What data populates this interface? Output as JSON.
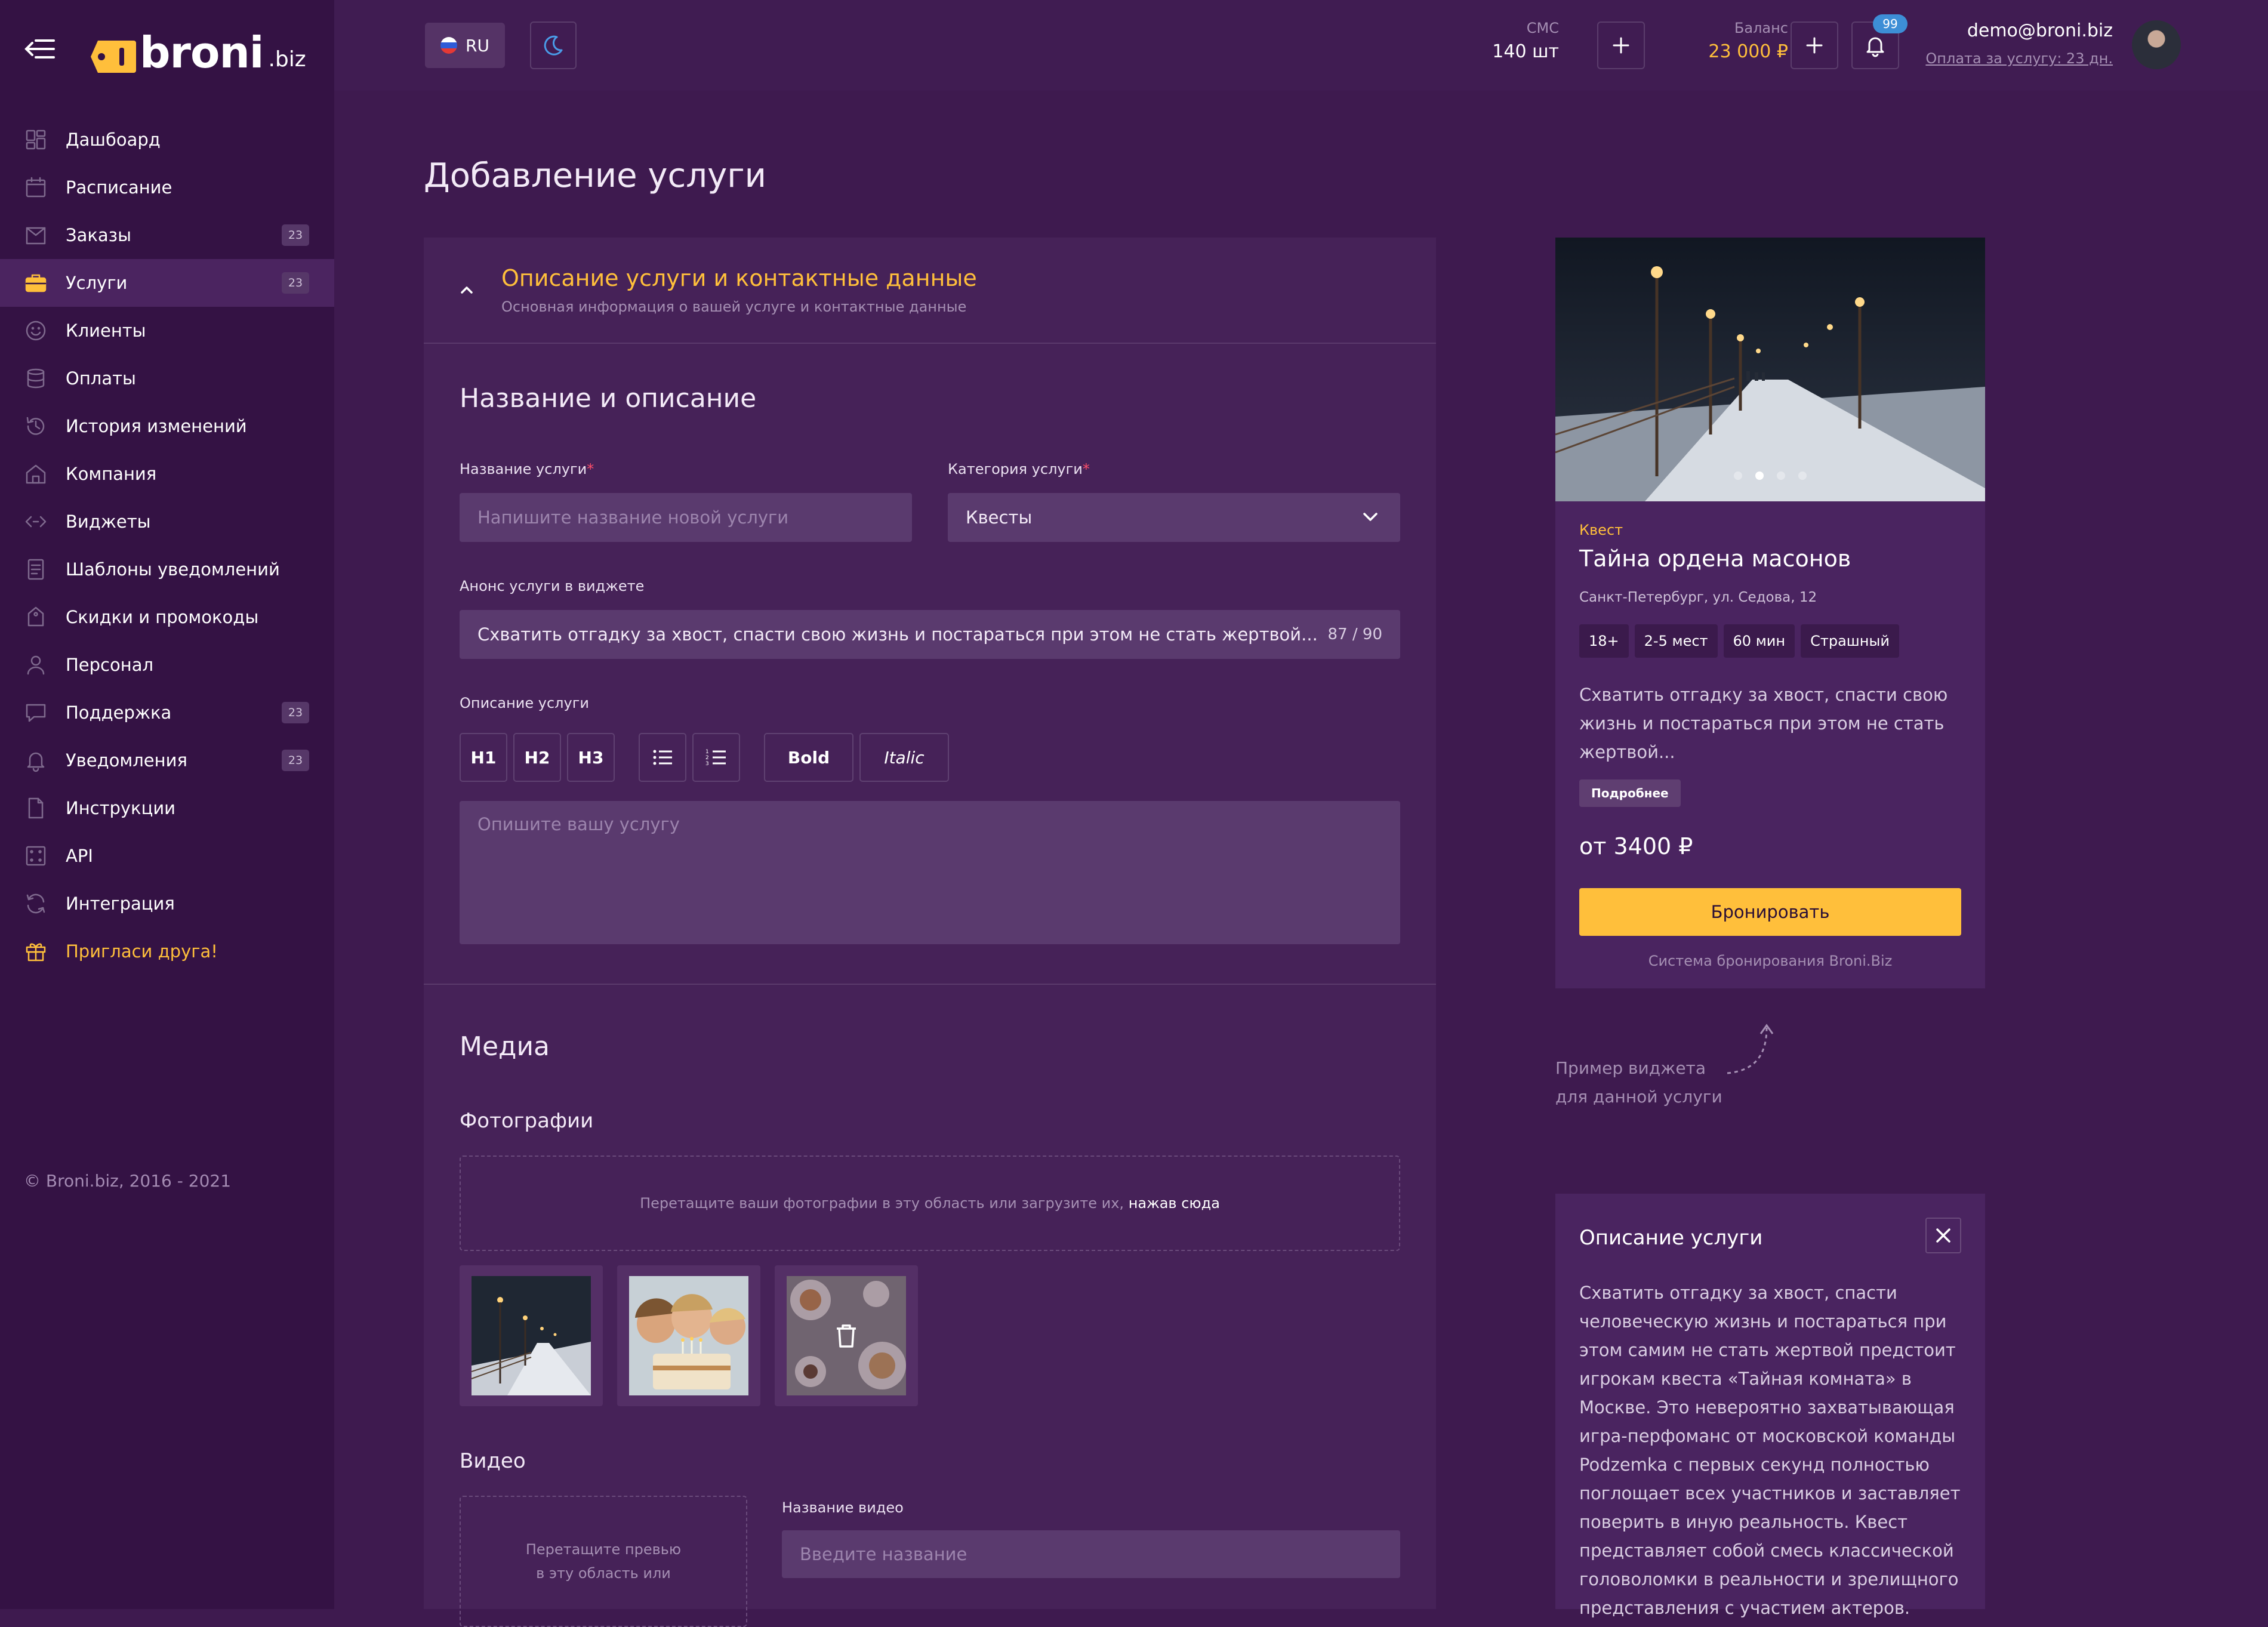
{
  "brand": {
    "name": "broni",
    "suffix": ".biz"
  },
  "sidebar": {
    "items": [
      {
        "label": "Дашбоард",
        "icon": "dashboard-icon"
      },
      {
        "label": "Расписание",
        "icon": "calendar-icon"
      },
      {
        "label": "Заказы",
        "icon": "inbox-icon",
        "badge": "23"
      },
      {
        "label": "Услуги",
        "icon": "briefcase-icon",
        "badge": "23",
        "active": true
      },
      {
        "label": "Клиенты",
        "icon": "smile-icon"
      },
      {
        "label": "Оплаты",
        "icon": "database-icon"
      },
      {
        "label": "История изменений",
        "icon": "history-icon"
      },
      {
        "label": "Компания",
        "icon": "home-icon"
      },
      {
        "label": "Виджеты",
        "icon": "code-icon"
      },
      {
        "label": "Шаблоны уведомлений",
        "icon": "document-icon"
      },
      {
        "label": "Скидки и промокоды",
        "icon": "tag-icon"
      },
      {
        "label": "Персонал",
        "icon": "user-icon"
      },
      {
        "label": "Поддержка",
        "icon": "chat-icon",
        "badge": "23"
      },
      {
        "label": "Уведомления",
        "icon": "bell-icon",
        "badge": "23"
      },
      {
        "label": "Инструкции",
        "icon": "file-icon"
      },
      {
        "label": "API",
        "icon": "api-icon"
      },
      {
        "label": "Интеграция",
        "icon": "sync-icon"
      },
      {
        "label": "Пригласи друга!",
        "icon": "gift-icon",
        "highlight": true
      }
    ],
    "copyright": "© Broni.biz, 2016 - 2021"
  },
  "topbar": {
    "language": "RU",
    "sms": {
      "label": "СМС",
      "value": "140 шт"
    },
    "balance": {
      "label": "Баланс",
      "value": "23 000 ₽"
    },
    "notifications_count": "99",
    "user_email": "demo@broni.biz",
    "payment_note": "Оплата за услугу: 23 дн."
  },
  "colors": {
    "accent": "#ffbf3b",
    "background": "#3e1a4f",
    "sidebar": "#341244",
    "badge_blue": "#3d8ed6"
  },
  "page": {
    "title": "Добавление услуги"
  },
  "form": {
    "accordion_title": "Описание услуги и контактные данные",
    "accordion_subtitle": "Основная информация о вашей услуге и контактные данные",
    "section_name": "Название и описание",
    "service_name_label": "Название услуги",
    "service_name_placeholder": "Напишите название новой услуги",
    "category_label": "Категория услуги",
    "category_value": "Квесты",
    "announce_label": "Анонс услуги в виджете",
    "announce_value": "Схватить отгадку за хвост, спасти свою жизнь и постараться при этом не стать жертвой...",
    "announce_counter": "87 / 90",
    "description_label": "Описание услуги",
    "toolbar": {
      "h1": "H1",
      "h2": "H2",
      "h3": "H3",
      "bold": "Bold",
      "italic": "Italic"
    },
    "description_placeholder": "Опишите вашу услугу",
    "media_title": "Медиа",
    "photos_title": "Фотографии",
    "photos_drop_text": "Перетащите ваши фотографии в эту область или загрузите их,",
    "photos_drop_link": "нажав сюда",
    "video_title": "Видео",
    "video_drop_line1": "Перетащите превью",
    "video_drop_line2": "в эту область или",
    "video_name_label": "Название видео",
    "video_name_placeholder": "Введите название"
  },
  "widget_preview": {
    "category": "Квест",
    "title": "Тайна ордена масонов",
    "address": "Санкт-Петербург, ул. Седова, 12",
    "tags": [
      "18+",
      "2-5 мест",
      "60 мин",
      "Страшный"
    ],
    "description": "Схватить отгадку за хвост, спасти свою жизнь и постараться при этом не стать жертвой...",
    "more_label": "Подробнее",
    "price": "от 3400 ₽",
    "book_label": "Бронировать",
    "footer": "Система бронирования Broni.Biz",
    "slide_count": 4,
    "active_slide": 2
  },
  "hint": {
    "line1": "Пример виджета",
    "line2": "для данной услуги"
  },
  "description_card": {
    "title": "Описание услуги",
    "text": "Схватить отгадку за хвост, спасти человеческую жизнь и постараться при этом самим не стать жертвой предстоит игрокам квеста «Тайная комната» в Москве. Это невероятно захватывающая игра-перфоманс от московской команды Podzemka с первых секунд полностью поглощает всех участников и заставляет поверить в иную реальность. Квест представляет собой смесь классической головоломки в реальности и зрелищного представления с участием актеров."
  }
}
